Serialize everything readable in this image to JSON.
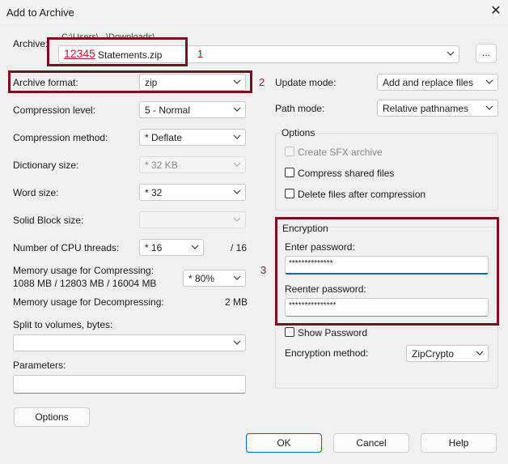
{
  "window": {
    "title": "Add to Archive"
  },
  "archive": {
    "label": "Archive:",
    "path_display": "C:\\Users\\...\\Downloads\\",
    "name_highlight": "12345",
    "name_rest": "Statements.zip",
    "browse": "..."
  },
  "left": {
    "format_label": "Archive format:",
    "format_value": "zip",
    "level_label": "Compression level:",
    "level_value": "5 - Normal",
    "method_label": "Compression method:",
    "method_value": "* Deflate",
    "dict_label": "Dictionary size:",
    "dict_value": "* 32 KB",
    "word_label": "Word size:",
    "word_value": "* 32",
    "solid_label": "Solid Block size:",
    "solid_value": "",
    "cpu_label": "Number of CPU threads:",
    "cpu_value": "* 16",
    "cpu_total": "/ 16",
    "mem_comp_label": "Memory usage for Compressing:",
    "mem_comp_detail": "1088 MB / 12803 MB / 16004 MB",
    "mem_comp_value": "* 80%",
    "mem_decomp_label": "Memory usage for Decompressing:",
    "mem_decomp_value": "2 MB",
    "split_label": "Split to volumes, bytes:",
    "split_value": "",
    "params_label": "Parameters:",
    "params_value": "",
    "options_button": "Options"
  },
  "right": {
    "update_label": "Update mode:",
    "update_value": "Add and replace files",
    "path_label": "Path mode:",
    "path_value": "Relative pathnames",
    "options_group": "Options",
    "sfx_label": "Create SFX archive",
    "shared_label": "Compress shared files",
    "delete_label": "Delete files after compression",
    "enc_group": "Encryption",
    "enter_pw_label": "Enter password:",
    "enter_pw_value": "**************",
    "reenter_pw_label": "Reenter password:",
    "reenter_pw_value": "***************",
    "show_pw_label": "Show Password",
    "enc_method_label": "Encryption method:",
    "enc_method_value": "ZipCrypto"
  },
  "annotations": {
    "n1": "1",
    "n2": "2",
    "n3": "3",
    "color": "#7a0e1e"
  },
  "buttons": {
    "ok": "OK",
    "cancel": "Cancel",
    "help": "Help"
  }
}
